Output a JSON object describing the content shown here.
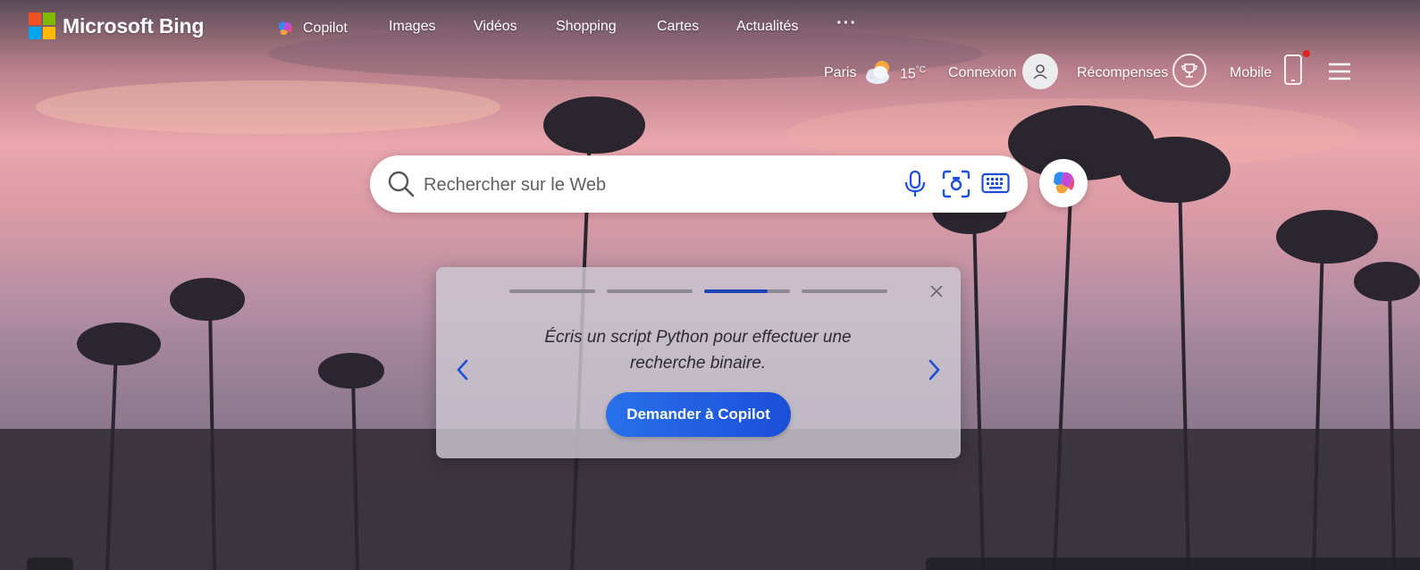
{
  "brand": {
    "name": "Microsoft Bing",
    "logo_colors": [
      "#f25022",
      "#7fba00",
      "#00a4ef",
      "#ffb900"
    ]
  },
  "nav": {
    "copilot": "Copilot",
    "images": "Images",
    "videos": "Vidéos",
    "shopping": "Shopping",
    "maps": "Cartes",
    "news": "Actualités",
    "more": "···"
  },
  "header_right": {
    "city": "Paris",
    "temperature": "15",
    "unit": "°C",
    "weather_icon": "partly-cloudy-icon",
    "signin": "Connexion",
    "rewards": "Récompenses",
    "mobile": "Mobile"
  },
  "search": {
    "placeholder": "Rechercher sur le Web"
  },
  "prompt_card": {
    "text": "Écris un script Python pour effectuer une recherche binaire.",
    "button": "Demander à Copilot",
    "step_count": 4,
    "active_step": 3,
    "active_step_progress": 0.74
  },
  "colors": {
    "accent": "#1b4fd8",
    "nav_text": "#ffffff"
  }
}
